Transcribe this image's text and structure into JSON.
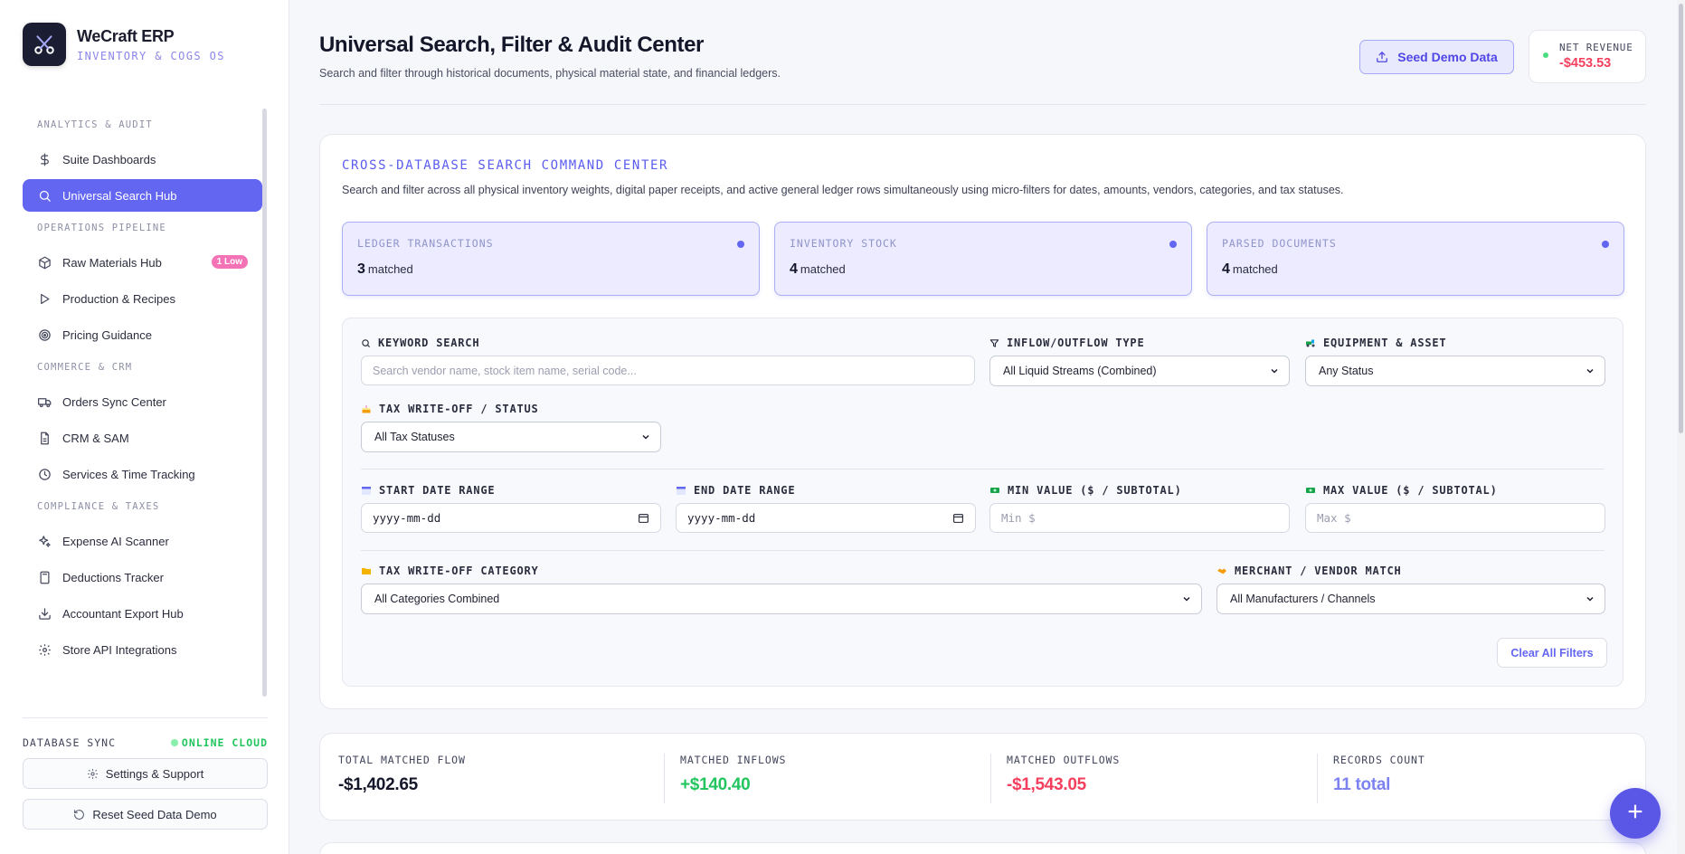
{
  "brand": {
    "name": "WeCraft ERP",
    "subtitle": "INVENTORY & COGS OS",
    "logo_icon": "scissors-icon"
  },
  "sidebar": {
    "sections": [
      {
        "title": "ANALYTICS & AUDIT",
        "items": [
          {
            "label": "Suite Dashboards",
            "icon": "dollar-icon"
          },
          {
            "label": "Universal Search Hub",
            "icon": "search-icon",
            "active": true
          }
        ]
      },
      {
        "title": "OPERATIONS PIPELINE",
        "items": [
          {
            "label": "Raw Materials Hub",
            "icon": "box-icon",
            "badge": "1 Low"
          },
          {
            "label": "Production & Recipes",
            "icon": "play-icon"
          },
          {
            "label": "Pricing Guidance",
            "icon": "target-icon"
          }
        ]
      },
      {
        "title": "COMMERCE & CRM",
        "items": [
          {
            "label": "Orders Sync Center",
            "icon": "truck-icon"
          },
          {
            "label": "CRM & SAM",
            "icon": "document-icon"
          },
          {
            "label": "Services & Time Tracking",
            "icon": "clock-icon"
          }
        ]
      },
      {
        "title": "COMPLIANCE & TAXES",
        "items": [
          {
            "label": "Expense AI Scanner",
            "icon": "sparkle-icon"
          },
          {
            "label": "Deductions Tracker",
            "icon": "calculator-icon"
          },
          {
            "label": "Accountant Export Hub",
            "icon": "download-icon"
          },
          {
            "label": "Store API Integrations",
            "icon": "gear-icon"
          }
        ]
      }
    ],
    "db_sync_label": "DATABASE SYNC",
    "db_sync_status": "ONLINE CLOUD",
    "settings_label": "Settings & Support",
    "reset_label": "Reset Seed Data Demo"
  },
  "header": {
    "title": "Universal Search, Filter & Audit Center",
    "subtitle": "Search and filter through historical documents, physical material state, and financial ledgers.",
    "seed_button": "Seed Demo Data",
    "net_revenue_label": "NET REVENUE",
    "net_revenue_value": "-$453.53"
  },
  "command_center": {
    "title": "CROSS-DATABASE SEARCH COMMAND CENTER",
    "description": "Search and filter across all physical inventory weights, digital paper receipts, and active general ledger rows simultaneously using micro-filters for dates, amounts, vendors, categories, and tax statuses.",
    "stats": [
      {
        "label": "LEDGER TRANSACTIONS",
        "count": "3",
        "suffix": "matched"
      },
      {
        "label": "INVENTORY STOCK",
        "count": "4",
        "suffix": "matched"
      },
      {
        "label": "PARSED DOCUMENTS",
        "count": "4",
        "suffix": "matched"
      }
    ],
    "filters": {
      "keyword_label": "KEYWORD SEARCH",
      "keyword_placeholder": "Search vendor name, stock item name, serial code...",
      "flow_label": "INFLOW/OUTFLOW TYPE",
      "flow_value": "All Liquid Streams (Combined)",
      "equipment_label": "EQUIPMENT & ASSET",
      "equipment_value": "Any Status",
      "tax_status_label": "TAX WRITE-OFF / STATUS",
      "tax_status_value": "All Tax Statuses",
      "start_date_label": "START DATE RANGE",
      "start_date_value": "yyyy-mm-dd",
      "end_date_label": "END DATE RANGE",
      "end_date_value": "yyyy-mm-dd",
      "min_label": "MIN VALUE ($ / SUBTOTAL)",
      "min_placeholder": "Min $",
      "max_label": "MAX VALUE ($ / SUBTOTAL)",
      "max_placeholder": "Max $",
      "category_label": "TAX WRITE-OFF CATEGORY",
      "category_value": "All Categories Combined",
      "vendor_label": "MERCHANT / VENDOR MATCH",
      "vendor_value": "All Manufacturers / Channels",
      "clear_button": "Clear All Filters"
    }
  },
  "summary": [
    {
      "label": "TOTAL MATCHED FLOW",
      "value": "-$1,402.65",
      "color": "#14162a"
    },
    {
      "label": "MATCHED INFLOWS",
      "value": "+$140.40",
      "color": "#22c55e"
    },
    {
      "label": "MATCHED OUTFLOWS",
      "value": "-$1,543.05",
      "color": "#f43f5e"
    },
    {
      "label": "RECORDS COUNT",
      "value": "11 total",
      "color": "#7c83f0"
    }
  ],
  "colors": {
    "accent": "#6366f1",
    "negative": "#f43f5e",
    "positive": "#22c55e"
  }
}
